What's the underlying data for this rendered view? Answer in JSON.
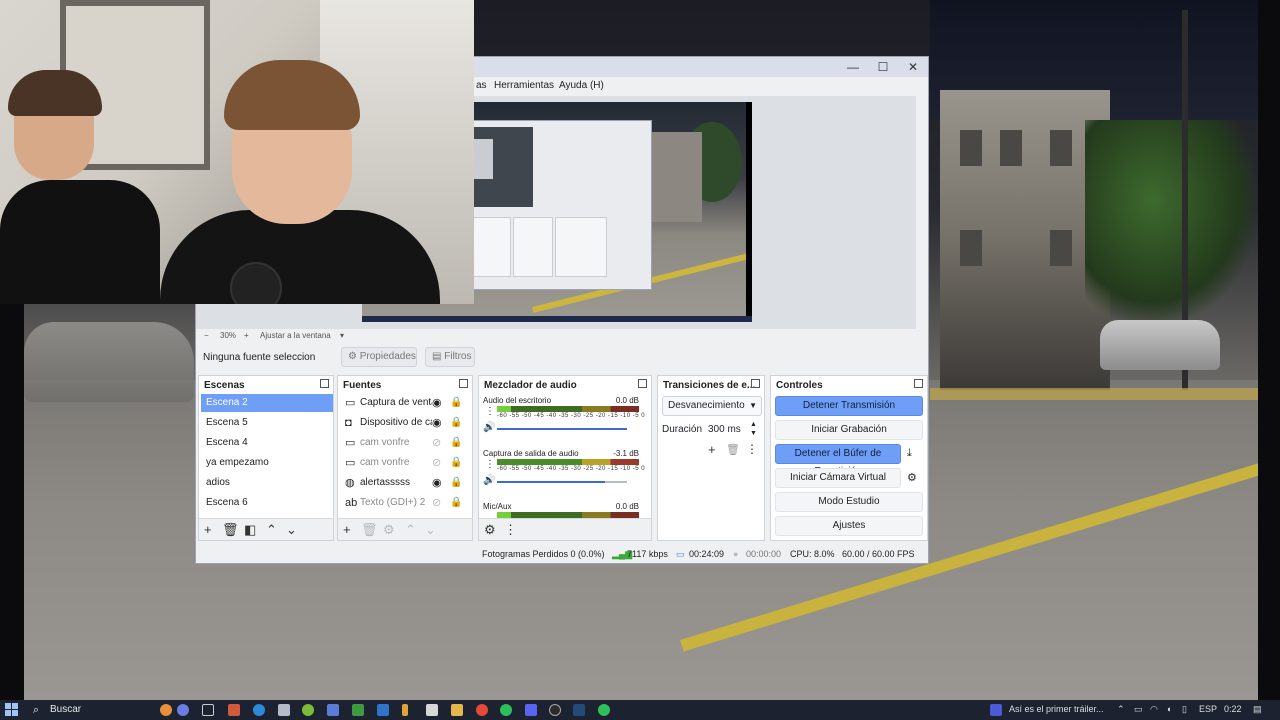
{
  "obs": {
    "menu": [
      "as",
      "Herramientas",
      "Ayuda (H)"
    ],
    "window_buttons": {
      "minimize": "—",
      "maximize": "☐",
      "close": "✕"
    },
    "zoom": {
      "level": "30%",
      "minus": "−",
      "plus": "+",
      "fit": "Ajustar a la ventana",
      "arrow": "▾"
    },
    "source_toolbar": {
      "no_source": "Ninguna fuente seleccionada",
      "properties": "Propiedades",
      "filters": "Filtros"
    },
    "scenes": {
      "title": "Escenas",
      "items": [
        "Escena 2",
        "Escena 5",
        "Escena 4",
        "ya empezamo",
        "adios",
        "Escena 6"
      ],
      "selected": "Escena 2"
    },
    "sources": {
      "title": "Fuentes",
      "items": [
        {
          "label": "Captura de ventana",
          "icon": "window-icon",
          "visible": true
        },
        {
          "label": "Dispositivo de captura",
          "icon": "camera-icon",
          "visible": true
        },
        {
          "label": "cam vonfre",
          "icon": "window-icon",
          "visible": false
        },
        {
          "label": "cam vonfre",
          "icon": "window-icon",
          "visible": false
        },
        {
          "label": "alertasssss",
          "icon": "browser-icon",
          "visible": true
        },
        {
          "label": "Texto (GDI+) 2",
          "icon": "text-icon",
          "visible": false
        }
      ]
    },
    "mixer": {
      "title": "Mezclador de audio",
      "scale": "-60 -55 -50 -45 -40 -35 -30 -25 -20 -15 -10 -5 0",
      "channels": [
        {
          "name": "Audio del escritorio",
          "db": "0.0 dB",
          "volume": 1.0
        },
        {
          "name": "Captura de salida de audio",
          "db": "-3.1 dB",
          "volume": 0.83
        },
        {
          "name": "Mic/Aux",
          "db": "0.0 dB",
          "volume": 1.0
        }
      ]
    },
    "transitions": {
      "title": "Transiciones de e...",
      "selected": "Desvanecimiento",
      "duration_label": "Duración",
      "duration_value": "300 ms"
    },
    "controls": {
      "title": "Controles",
      "stop_stream": "Detener Transmisión",
      "start_recording": "Iniciar Grabación",
      "stop_replay": "Detener el Búfer de Repetición",
      "start_virtual_cam": "Iniciar Cámara Virtual",
      "studio_mode": "Modo Estudio",
      "settings": "Ajustes"
    },
    "status": {
      "dropped": "Fotogramas Perdidos 0 (0.0%)",
      "bitrate": "7117 kbps",
      "stream_time": "00:24:09",
      "rec_time": "00:00:00",
      "cpu": "CPU: 8.0%",
      "fps": "60.00 / 60.00 FPS"
    }
  },
  "taskbar": {
    "search_placeholder": "Buscar",
    "notification": "Así es el primer tráiler...",
    "language": "ESP",
    "time": "0:22"
  },
  "colors": {
    "accent": "#6f9ef7",
    "taskbar": "#1c2230"
  }
}
